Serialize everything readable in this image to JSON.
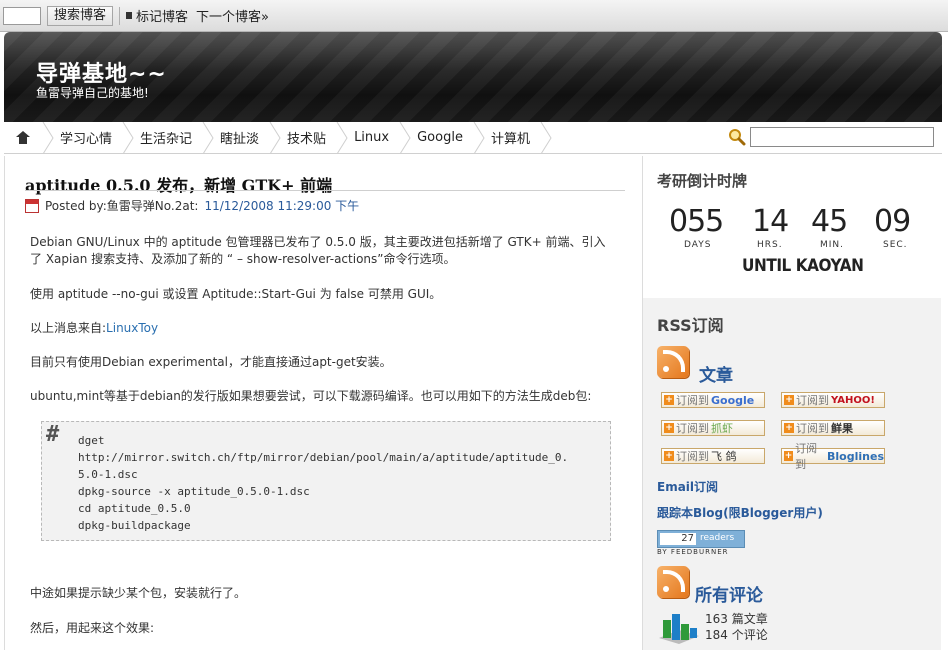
{
  "navbar": {
    "search_blog": "搜索博客",
    "flag_blog": "标记博客",
    "next_blog": "下一个博客»"
  },
  "header": {
    "title": "导弹基地~~",
    "subtitle": "鱼雷导弹自己的基地!"
  },
  "menu": {
    "items": [
      "学习心情",
      "生活杂记",
      "瞎扯淡",
      "技术贴",
      "Linux",
      "Google",
      "计算机"
    ]
  },
  "post": {
    "title": "aptitude 0.5.0 发布，新增  GTK+ 前端",
    "posted_by": "Posted by:鱼雷导弹No.2at:",
    "timestamp": "11/12/2008 11:29:00 下午",
    "p1_line1": "Debian GNU/Linux 中的  aptitude 包管理器已发布了  0.5.0 版，其主要改进包括新增了  GTK+ 前端、引入",
    "p1_line2": "了  Xapian 搜索支持、及添加了新的 “ – show-resolver-actions”命令行选项。",
    "p2": "使用  aptitude --no-gui 或设置  Aptitude::Start-Gui 为  false 可禁用  GUI。",
    "p3_prefix": "以上消息来自:",
    "p3_link": "LinuxToy",
    "p4": "目前只有使用Debian experimental，才能直接通过apt-get安装。",
    "p5": "ubuntu,mint等基于debian的发行版如果想要尝试，可以下载源码编译。也可以用如下的方法生成deb包:",
    "code_hash": "#",
    "code": [
      "dget",
      "http://mirror.switch.ch/ftp/mirror/debian/pool/main/a/aptitude/aptitude_0.",
      "5.0-1.dsc",
      "dpkg-source -x aptitude_0.5.0-1.dsc",
      "cd aptitude_0.5.0",
      "dpkg-buildpackage"
    ],
    "p6": "中途如果提示缺少某个包，安装就行了。",
    "p7": "然后，用起来这个效果:"
  },
  "sidebar": {
    "countdown_heading": "考研倒计时牌",
    "countdown": [
      {
        "value": "055",
        "label": "DAYS"
      },
      {
        "value": "14",
        "label": "HRS."
      },
      {
        "value": "45",
        "label": "MIN."
      },
      {
        "value": "09",
        "label": "SEC."
      }
    ],
    "until": "UNTIL KAOYAN",
    "rss_heading": "RSS订阅",
    "articles_label": "文章",
    "subscribe_prefix": "订阅到",
    "subscribe_targets": [
      "Google",
      "YAHOO!",
      "抓虾",
      "鲜果",
      "飞 鸽",
      "Bloglines"
    ],
    "email_link": "Email订阅",
    "track_link": "跟踪本Blog(限Blogger用户)",
    "feedburner_count": "27",
    "feedburner_readers": "readers",
    "feedburner_by": "BY FEEDBURNER",
    "comments_label": "所有评论",
    "articles_count": "163 篇文章",
    "comments_count": "184 个评论"
  },
  "colors": {
    "link_blue": "#2a5a9a",
    "rss_orange": "#e4761b",
    "header_dark": "#111111"
  }
}
